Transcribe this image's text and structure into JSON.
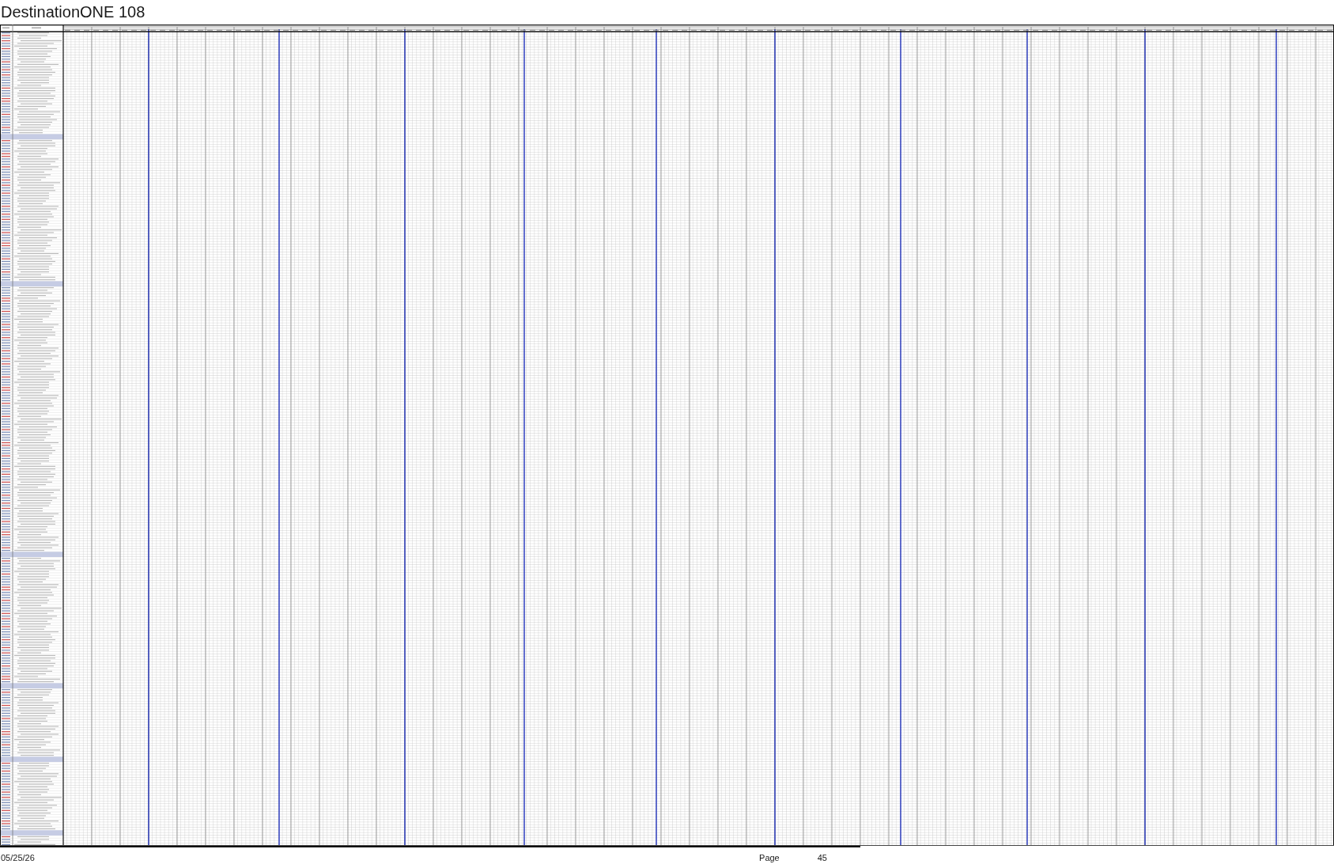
{
  "document": {
    "title": "DestinationONE 108"
  },
  "footer": {
    "date": "05/25/26",
    "page_label": "Page",
    "page_number": "45"
  }
}
